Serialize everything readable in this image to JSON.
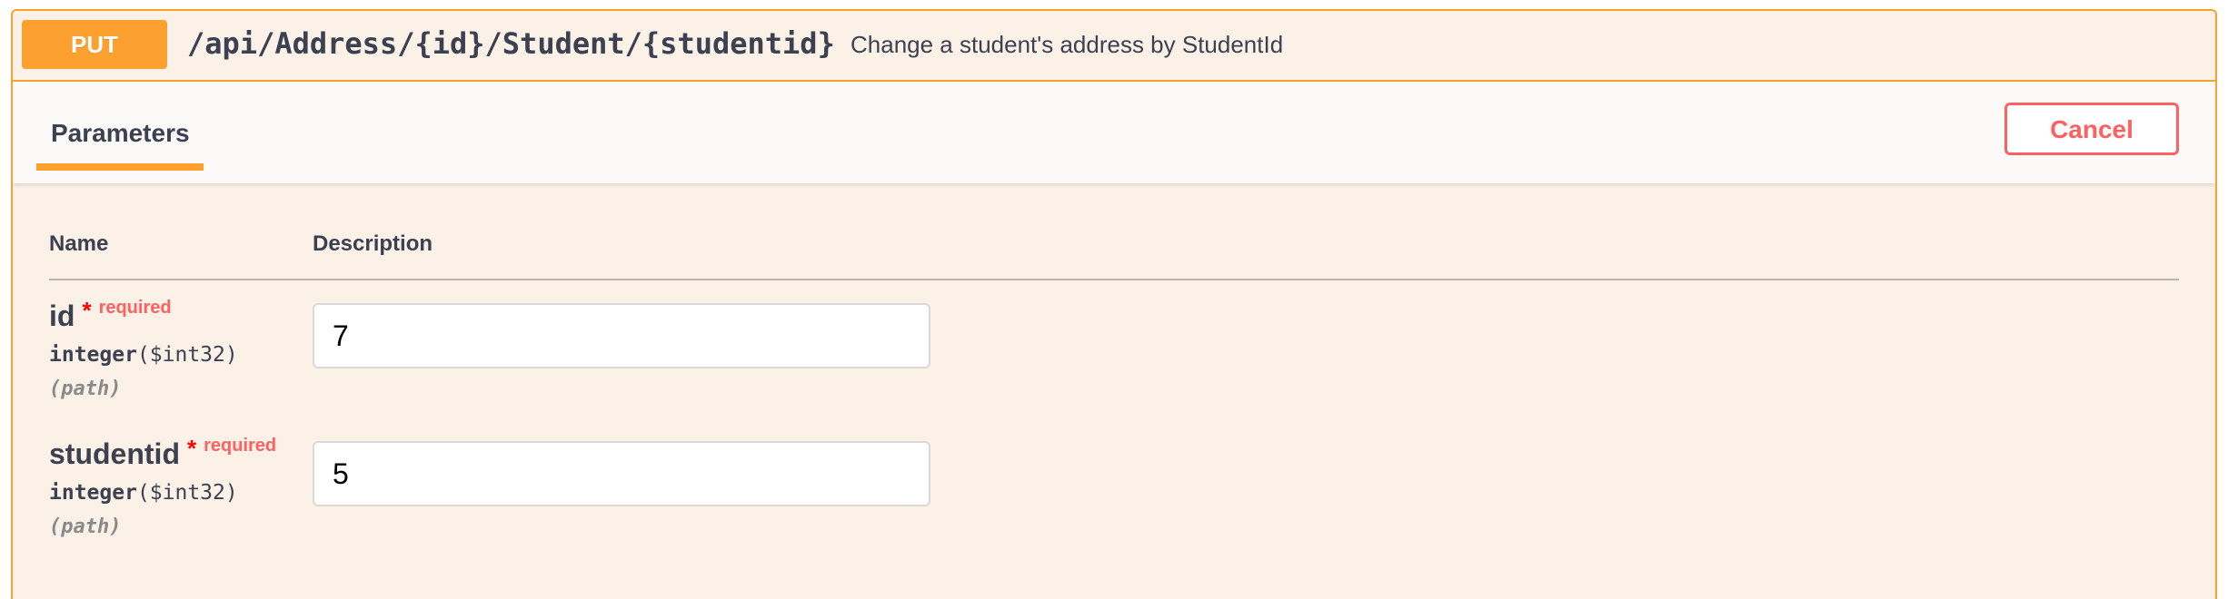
{
  "summary": {
    "method": "PUT",
    "path": "/api/Address/{id}/Student/{studentid}",
    "description": "Change a student's address by StudentId"
  },
  "section": {
    "tab_label": "Parameters",
    "cancel_label": "Cancel"
  },
  "table": {
    "col_name": "Name",
    "col_description": "Description"
  },
  "params": [
    {
      "name": "id",
      "required_star": "*",
      "required_text": "required",
      "type": "integer",
      "format": "($int32)",
      "in": "(path)",
      "value": "7"
    },
    {
      "name": "studentid",
      "required_star": "*",
      "required_text": "required",
      "type": "integer",
      "format": "($int32)",
      "in": "(path)",
      "value": "5"
    }
  ],
  "colors": {
    "accent": "#fca130",
    "background": "#fbf1e7",
    "cancel": "#ff6060",
    "required": "#ff0000",
    "text": "#3b4151"
  }
}
